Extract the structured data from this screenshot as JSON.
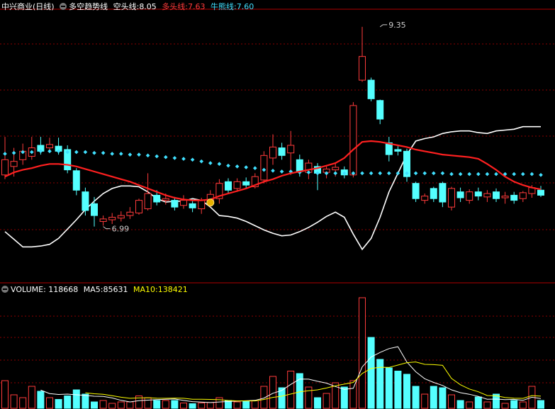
{
  "price_legend": {
    "stock": "中兴商业(日线)",
    "indicator": "多空趋势线",
    "short_label": "空头线:",
    "short_value": "8.05",
    "long_label": "多头线:",
    "long_value": "7.63",
    "bull_label": "牛熊线:",
    "bull_value": "7.60"
  },
  "volume_legend": {
    "volume_label": "VOLUME:",
    "volume_value": "118668",
    "ma5_label": "MA5:",
    "ma5_value": "85631",
    "ma10_label": "MA10:",
    "ma10_value": "138421"
  },
  "colors": {
    "up": "#ff3b3b",
    "down": "#54ffff",
    "long_line": "#ff2020",
    "short_line": "#ffffff",
    "bull_line": "#40e0ff",
    "ma10": "#ffff00",
    "grid": "#8b0000"
  },
  "chart_data": [
    {
      "type": "candlestick",
      "title": "中兴商业(日线)",
      "annotations": [
        {
          "label": "9.35",
          "x_index": 42,
          "value": 9.35
        },
        {
          "label": "6.99",
          "x_index": 11,
          "value": 6.99
        }
      ],
      "ylim": [
        6.35,
        9.55
      ],
      "candles": [
        {
          "o": 7.6,
          "c": 7.78,
          "h": 8.05,
          "l": 7.55
        },
        {
          "o": 7.7,
          "c": 7.76,
          "h": 7.92,
          "l": 7.58
        },
        {
          "o": 7.78,
          "c": 7.88,
          "h": 7.97,
          "l": 7.72
        },
        {
          "o": 7.82,
          "c": 7.92,
          "h": 8.05,
          "l": 7.78
        },
        {
          "o": 7.95,
          "c": 7.88,
          "h": 8.05,
          "l": 7.84
        },
        {
          "o": 7.92,
          "c": 7.96,
          "h": 8.04,
          "l": 7.86
        },
        {
          "o": 7.94,
          "c": 7.88,
          "h": 8.04,
          "l": 7.84
        },
        {
          "o": 7.9,
          "c": 7.66,
          "h": 7.95,
          "l": 7.62
        },
        {
          "o": 7.65,
          "c": 7.42,
          "h": 7.68,
          "l": 7.36
        },
        {
          "o": 7.4,
          "c": 7.18,
          "h": 7.45,
          "l": 7.12
        },
        {
          "o": 7.26,
          "c": 7.12,
          "h": 7.34,
          "l": 6.99
        },
        {
          "o": 7.05,
          "c": 7.08,
          "h": 7.12,
          "l": 7.0
        },
        {
          "o": 7.07,
          "c": 7.1,
          "h": 7.15,
          "l": 7.02
        },
        {
          "o": 7.09,
          "c": 7.12,
          "h": 7.17,
          "l": 7.05
        },
        {
          "o": 7.12,
          "c": 7.16,
          "h": 7.22,
          "l": 7.08
        },
        {
          "o": 7.15,
          "c": 7.3,
          "h": 7.32,
          "l": 7.13
        },
        {
          "o": 7.2,
          "c": 7.38,
          "h": 7.62,
          "l": 7.18
        },
        {
          "o": 7.36,
          "c": 7.28,
          "h": 7.42,
          "l": 7.24
        },
        {
          "o": 7.3,
          "c": 7.32,
          "h": 7.38,
          "l": 7.25
        },
        {
          "o": 7.3,
          "c": 7.22,
          "h": 7.34,
          "l": 7.18
        },
        {
          "o": 7.24,
          "c": 7.3,
          "h": 7.36,
          "l": 7.2
        },
        {
          "o": 7.26,
          "c": 7.21,
          "h": 7.32,
          "l": 7.16
        },
        {
          "o": 7.2,
          "c": 7.3,
          "h": 7.33,
          "l": 7.14
        },
        {
          "o": 7.26,
          "c": 7.37,
          "h": 7.42,
          "l": 7.22
        },
        {
          "o": 7.32,
          "c": 7.5,
          "h": 7.55,
          "l": 7.26
        },
        {
          "o": 7.52,
          "c": 7.42,
          "h": 7.56,
          "l": 7.38
        },
        {
          "o": 7.44,
          "c": 7.52,
          "h": 7.56,
          "l": 7.4
        },
        {
          "o": 7.52,
          "c": 7.48,
          "h": 7.57,
          "l": 7.44
        },
        {
          "o": 7.46,
          "c": 7.58,
          "h": 7.62,
          "l": 7.44
        },
        {
          "o": 7.54,
          "c": 7.83,
          "h": 7.88,
          "l": 7.5
        },
        {
          "o": 7.8,
          "c": 7.93,
          "h": 8.08,
          "l": 7.72
        },
        {
          "o": 7.92,
          "c": 7.83,
          "h": 7.98,
          "l": 7.78
        },
        {
          "o": 7.86,
          "c": 7.95,
          "h": 8.12,
          "l": 7.6
        },
        {
          "o": 7.78,
          "c": 7.64,
          "h": 7.84,
          "l": 7.58
        },
        {
          "o": 7.63,
          "c": 7.74,
          "h": 7.78,
          "l": 7.55
        },
        {
          "o": 7.7,
          "c": 7.62,
          "h": 7.74,
          "l": 7.42
        },
        {
          "o": 7.63,
          "c": 7.67,
          "h": 7.7,
          "l": 7.56
        },
        {
          "o": 7.66,
          "c": 7.69,
          "h": 7.74,
          "l": 7.58
        },
        {
          "o": 7.66,
          "c": 7.6,
          "h": 7.7,
          "l": 7.56
        },
        {
          "o": 7.6,
          "c": 8.42,
          "h": 8.46,
          "l": 7.57
        },
        {
          "o": 8.72,
          "c": 9.0,
          "h": 9.35,
          "l": 8.7
        },
        {
          "o": 8.72,
          "c": 8.5,
          "h": 8.75,
          "l": 8.47
        },
        {
          "o": 8.48,
          "c": 8.26,
          "h": 8.49,
          "l": 8.2
        },
        {
          "o": 7.98,
          "c": 7.84,
          "h": 8.05,
          "l": 7.76
        },
        {
          "o": 7.9,
          "c": 7.88,
          "h": 7.94,
          "l": 7.83
        },
        {
          "o": 7.88,
          "c": 7.58,
          "h": 7.91,
          "l": 7.52
        },
        {
          "o": 7.5,
          "c": 7.32,
          "h": 7.52,
          "l": 7.28
        },
        {
          "o": 7.3,
          "c": 7.35,
          "h": 7.38,
          "l": 7.26
        },
        {
          "o": 7.44,
          "c": 7.32,
          "h": 7.46,
          "l": 7.28
        },
        {
          "o": 7.5,
          "c": 7.28,
          "h": 7.52,
          "l": 7.22
        },
        {
          "o": 7.22,
          "c": 7.44,
          "h": 7.46,
          "l": 7.18
        },
        {
          "o": 7.4,
          "c": 7.33,
          "h": 7.45,
          "l": 7.28
        },
        {
          "o": 7.3,
          "c": 7.4,
          "h": 7.43,
          "l": 7.26
        },
        {
          "o": 7.4,
          "c": 7.35,
          "h": 7.45,
          "l": 7.3
        },
        {
          "o": 7.34,
          "c": 7.38,
          "h": 7.42,
          "l": 7.28
        },
        {
          "o": 7.4,
          "c": 7.32,
          "h": 7.44,
          "l": 7.28
        },
        {
          "o": 7.33,
          "c": 7.35,
          "h": 7.4,
          "l": 7.26
        },
        {
          "o": 7.36,
          "c": 7.3,
          "h": 7.4,
          "l": 7.26
        },
        {
          "o": 7.32,
          "c": 7.39,
          "h": 7.41,
          "l": 7.28
        },
        {
          "o": 7.38,
          "c": 7.45,
          "h": 7.48,
          "l": 7.33
        },
        {
          "o": 7.42,
          "c": 7.36,
          "h": 7.47,
          "l": 7.34
        }
      ],
      "series": [
        {
          "name": "空头线",
          "values": [
            6.93,
            6.84,
            6.75,
            6.75,
            6.76,
            6.78,
            6.85,
            6.96,
            7.07,
            7.19,
            7.29,
            7.38,
            7.44,
            7.47,
            7.47,
            7.46,
            7.4,
            7.32,
            7.28,
            7.29,
            7.29,
            7.32,
            7.3,
            7.22,
            7.12,
            7.11,
            7.09,
            7.05,
            7.0,
            6.95,
            6.91,
            6.88,
            6.89,
            6.93,
            6.98,
            7.04,
            7.11,
            7.16,
            7.1,
            6.9,
            6.72,
            6.85,
            7.1,
            7.4,
            7.62,
            7.84,
            8.0,
            8.03,
            8.05,
            8.09,
            8.11,
            8.12,
            8.12,
            8.1,
            8.09,
            8.12,
            8.13,
            8.14,
            8.17,
            8.17,
            8.17
          ]
        },
        {
          "name": "多头线",
          "values": [
            7.58,
            7.63,
            7.66,
            7.68,
            7.71,
            7.73,
            7.73,
            7.72,
            7.7,
            7.67,
            7.64,
            7.61,
            7.58,
            7.55,
            7.52,
            7.48,
            7.44,
            7.4,
            7.36,
            7.33,
            7.31,
            7.3,
            7.3,
            7.31,
            7.35,
            7.38,
            7.41,
            7.44,
            7.48,
            7.52,
            7.55,
            7.59,
            7.62,
            7.64,
            7.66,
            7.68,
            7.71,
            7.74,
            7.8,
            7.9,
            7.99,
            8.0,
            7.99,
            7.97,
            7.95,
            7.93,
            7.9,
            7.88,
            7.86,
            7.84,
            7.83,
            7.82,
            7.81,
            7.79,
            7.73,
            7.66,
            7.58,
            7.52,
            7.48,
            7.45,
            7.43
          ]
        },
        {
          "name": "牛熊线",
          "values": [
            7.85,
            7.86,
            7.87,
            7.87,
            7.88,
            7.88,
            7.88,
            7.87,
            7.87,
            7.87,
            7.86,
            7.86,
            7.85,
            7.85,
            7.84,
            7.84,
            7.83,
            7.82,
            7.81,
            7.8,
            7.79,
            7.78,
            7.76,
            7.74,
            7.73,
            7.71,
            7.7,
            7.69,
            7.68,
            7.66,
            7.65,
            7.64,
            7.64,
            7.63,
            7.63,
            7.62,
            7.62,
            7.62,
            7.62,
            7.62,
            7.62,
            7.62,
            7.62,
            7.62,
            7.62,
            7.62,
            7.62,
            7.62,
            7.62,
            7.62,
            7.61,
            7.61,
            7.61,
            7.61,
            7.61,
            7.61,
            7.61,
            7.61,
            7.61,
            7.61,
            7.6
          ]
        }
      ]
    },
    {
      "type": "bar",
      "title": "VOLUME",
      "ylim": [
        0,
        320000
      ],
      "volumes": [
        78000,
        38000,
        30000,
        62000,
        48000,
        30000,
        25000,
        35000,
        52000,
        40000,
        18000,
        22000,
        14000,
        18000,
        18000,
        35000,
        30000,
        22000,
        22000,
        22000,
        15000,
        13000,
        15000,
        16000,
        30000,
        22000,
        18000,
        20000,
        22000,
        62000,
        90000,
        58000,
        105000,
        98000,
        60000,
        30000,
        42000,
        72000,
        60000,
        78000,
        312000,
        200000,
        138000,
        114000,
        105000,
        96000,
        62000,
        40000,
        62000,
        58000,
        38000,
        22000,
        18000,
        32000,
        18000,
        40000,
        14000,
        22000,
        18000,
        62000,
        22000
      ],
      "series": [
        {
          "name": "MA5",
          "values": [
            null,
            null,
            null,
            null,
            51200,
            41600,
            39000,
            40000,
            38000,
            36400,
            34000,
            33400,
            29200,
            22400,
            18000,
            21400,
            23000,
            24600,
            25400,
            26200,
            22200,
            18800,
            17400,
            16200,
            17800,
            19200,
            20200,
            21200,
            22400,
            28800,
            42400,
            50400,
            67400,
            82600,
            82200,
            76200,
            71000,
            61400,
            53600,
            56400,
            116800,
            144600,
            157600,
            168400,
            173800,
            130600,
            103000,
            83400,
            73000,
            64400,
            52000,
            44000,
            39600,
            33600,
            25600,
            26000,
            24400,
            25200,
            22400,
            31200,
            27600
          ]
        },
        {
          "name": "MA10",
          "values": [
            null,
            null,
            null,
            null,
            null,
            null,
            null,
            null,
            null,
            43800,
            41000,
            39400,
            35600,
            31200,
            28300,
            29300,
            29700,
            28400,
            28300,
            28800,
            28300,
            25400,
            25600,
            25000,
            24200,
            22300,
            20700,
            20700,
            20800,
            25000,
            30700,
            34300,
            40300,
            46500,
            49500,
            51900,
            57300,
            63400,
            68200,
            73100,
            98300,
            112600,
            115800,
            115400,
            122000,
            128700,
            130700,
            124100,
            123300,
            121200,
            84200,
            66400,
            54400,
            46600,
            36000,
            35200,
            30400,
            28600,
            28000,
            35800,
            34200
          ]
        }
      ]
    }
  ]
}
